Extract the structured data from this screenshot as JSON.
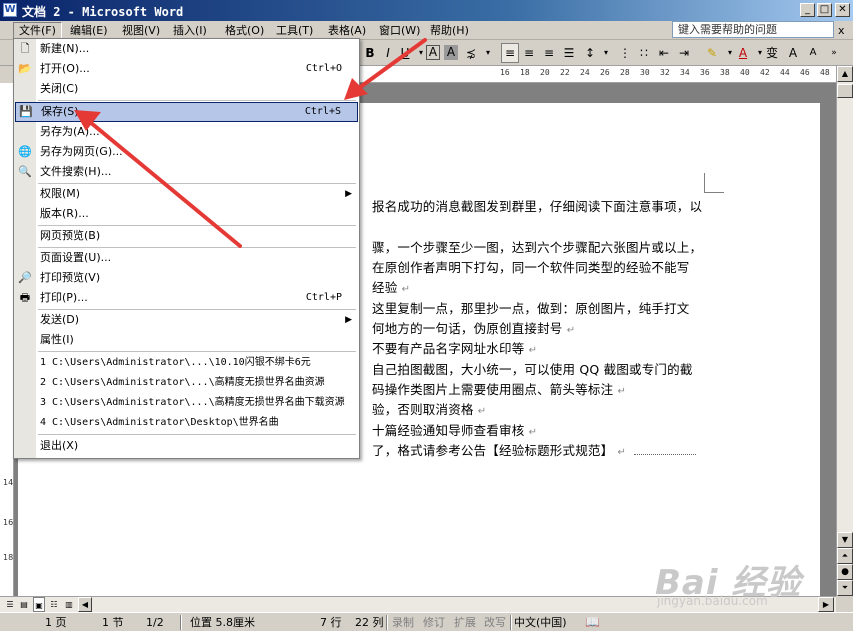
{
  "window": {
    "title": "文档 2 - Microsoft Word",
    "app_icon": "W",
    "controls": [
      "_",
      "□",
      "✕"
    ]
  },
  "menubar": {
    "items": [
      "文件(F)",
      "编辑(E)",
      "视图(V)",
      "插入(I)",
      "格式(O)",
      "工具(T)",
      "表格(A)",
      "窗口(W)",
      "帮助(H)"
    ],
    "help_placeholder": "键入需要帮助的问题",
    "mdi_close": "x"
  },
  "toolbar": {
    "bold": "B",
    "underline": "U",
    "char_border": "A",
    "char_shading": "A",
    "font_color": "A",
    "grow_font": "A",
    "shrink_font": "A"
  },
  "ruler": {
    "ticks": [
      "16",
      "18",
      "20",
      "22",
      "24",
      "26",
      "28",
      "30",
      "32",
      "34",
      "36",
      "38",
      "40",
      "42",
      "44",
      "46",
      "48"
    ]
  },
  "file_menu": {
    "items": [
      {
        "label": "新建(N)...",
        "icon": "new-doc-icon"
      },
      {
        "label": "打开(O)...",
        "shortcut": "Ctrl+O",
        "icon": "open-folder-icon"
      },
      {
        "label": "关闭(C)"
      },
      {
        "label": "保存(S)",
        "shortcut": "Ctrl+S",
        "icon": "save-disk-icon",
        "highlighted": true
      },
      {
        "label": "另存为(A)..."
      },
      {
        "label": "另存为网页(G)...",
        "icon": "web-page-icon"
      },
      {
        "label": "文件搜索(H)...",
        "icon": "search-file-icon"
      },
      {
        "label": "权限(M)",
        "submenu": true
      },
      {
        "label": "版本(R)..."
      },
      {
        "label": "网页预览(B)"
      },
      {
        "label": "页面设置(U)..."
      },
      {
        "label": "打印预览(V)",
        "icon": "print-preview-icon"
      },
      {
        "label": "打印(P)...",
        "shortcut": "Ctrl+P",
        "icon": "printer-icon"
      },
      {
        "label": "发送(D)",
        "submenu": true
      },
      {
        "label": "属性(I)"
      },
      {
        "label": "1 C:\\Users\\Administrator\\...\\10.10闪银不绑卡6元"
      },
      {
        "label": "2 C:\\Users\\Administrator\\...\\高精度无损世界名曲资源"
      },
      {
        "label": "3 C:\\Users\\Administrator\\...\\高精度无损世界名曲下载资源"
      },
      {
        "label": "4 C:\\Users\\Administrator\\Desktop\\世界名曲"
      },
      {
        "label": "退出(X)"
      }
    ]
  },
  "document": {
    "lines": [
      "报名成功的消息截图发到群里，仔细阅读下面注意事项，以",
      "骤，一个步骤至少一图，达到六个步骤配六张图片或以上，",
      "在原创作者声明下打勾，同一个软件同类型的经验不能写",
      "经验",
      "这里复制一点，那里抄一点，做到：原创图片，纯手打文",
      "何地方的一句话，伪原创直接封号",
      "不要有产品名字网址水印等",
      "自己拍图截图，大小统一，可以使用 QQ 截图或专门的截",
      "码操作类图片上需要使用圈点、箭头等标注",
      "验，否则取消资格",
      "十篇经验通知导师查看审核",
      "了，格式请参考公告【经验标题形式规范】"
    ],
    "para_mark": "↵"
  },
  "statusbar": {
    "page": "1 页",
    "section": "1 节",
    "page_of": "1/2",
    "position": "位置 5.8厘米",
    "line": "7 行",
    "column": "22 列",
    "rec": "录制",
    "trk": "修订",
    "ext": "扩展",
    "ovr": "改写",
    "language": "中文(中国)"
  },
  "watermark": {
    "main": "Bai 经验",
    "sub": "jingyan.baidu.com"
  },
  "colors": {
    "titlebar_start": "#0a246a",
    "titlebar_end": "#a6caf0",
    "menu_highlight": "#b6c6e8",
    "arrow_red": "#e53935",
    "chrome": "#d4d0c8"
  }
}
